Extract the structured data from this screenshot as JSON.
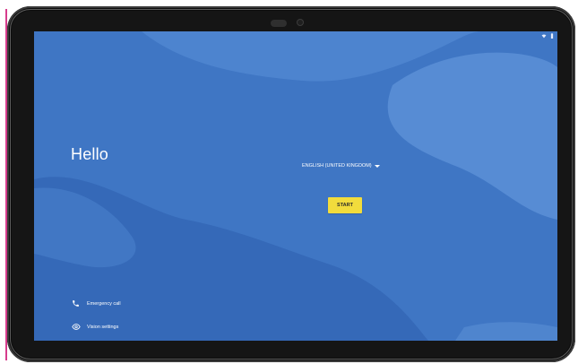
{
  "screen": {
    "greeting": "Hello",
    "language": {
      "label": "ENGLISH (UNITED KINGDOM)",
      "caret_icon": "chevron-down-icon"
    },
    "start_button": "START",
    "bottom_actions": {
      "emergency_call": {
        "label": "Emergency call",
        "icon": "phone-icon"
      },
      "vision_settings": {
        "label": "Vision settings",
        "icon": "eye-icon"
      }
    },
    "status_bar": {
      "icons": [
        "wifi-icon",
        "battery-icon"
      ]
    }
  },
  "colors": {
    "screen_background": "#3f76c4",
    "wave_light": "#5a8fd6",
    "wave_dark": "#3569b8",
    "start_button": "#f2dc3c",
    "bezel": "#151515"
  }
}
